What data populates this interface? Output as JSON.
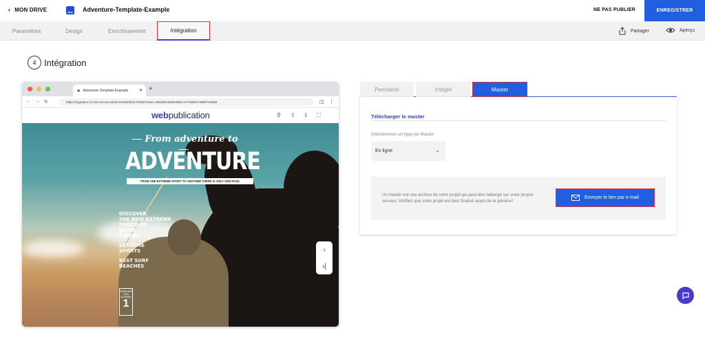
{
  "topbar": {
    "back_label": "MON DRIVE",
    "doc_badge": "INDD",
    "doc_title": "Adventure-Template-Example",
    "unpublish_label": "NE PAS PUBLIER",
    "save_label": "ENREGISTRER"
  },
  "tabs": [
    {
      "label": "Paramètres",
      "active": false
    },
    {
      "label": "Design",
      "active": false
    },
    {
      "label": "Enrichissement",
      "active": false
    },
    {
      "label": "Intégration",
      "active": true
    }
  ],
  "actions": {
    "share_label": "Partager",
    "preview_label": "Aperçu"
  },
  "section": {
    "step": "4",
    "title": "Intégration"
  },
  "browser": {
    "tab_title": "Adventure-Template-Example",
    "url": "https://migration-3.zone-secure.net/drive/45209/2175202/?token=3D3E0C659D4B0CAFF26E9FC9BDFC0808",
    "logo_web": "web",
    "logo_pub": "publication"
  },
  "magazine": {
    "from": "From adventure to",
    "headline": "ADVENTURE",
    "subline": "FROM ONE EXTREME SPORT TO ANOTHER THERE IS ONLY ONE PAGE",
    "side_1": [
      "DISCOVER",
      "THE NEW EXTREME",
      "PHOTO OF",
      "JAKOB",
      "OWENS"
    ],
    "side_2": [
      "EXTREME",
      "SPORTS"
    ],
    "side_3": [
      "BEST SURF",
      "BEACHES"
    ],
    "issue_month": "FEBRUARY 2024",
    "issue_label": "NUMBER",
    "issue_number": "1"
  },
  "integration_tabs": [
    {
      "label": "Permalink",
      "active": false
    },
    {
      "label": "Intégré",
      "active": false
    },
    {
      "label": "Master",
      "active": true
    }
  ],
  "master": {
    "title": "Télécharger le master",
    "select_label": "Sélectionnez un type de Master",
    "select_value": "En ligne",
    "info": "Un master est une archive de votre projet qui peut être hébergé sur votre propre serveur. Vérifiez que votre projet est bien finalisé avant de le générer!",
    "send_button": "Envoyer le lien par e-mail"
  },
  "colors": {
    "accent": "#1f5fe0",
    "highlight": "#e03434",
    "tab_underline": "#4a3ac8",
    "chat": "#4a3ac8"
  }
}
